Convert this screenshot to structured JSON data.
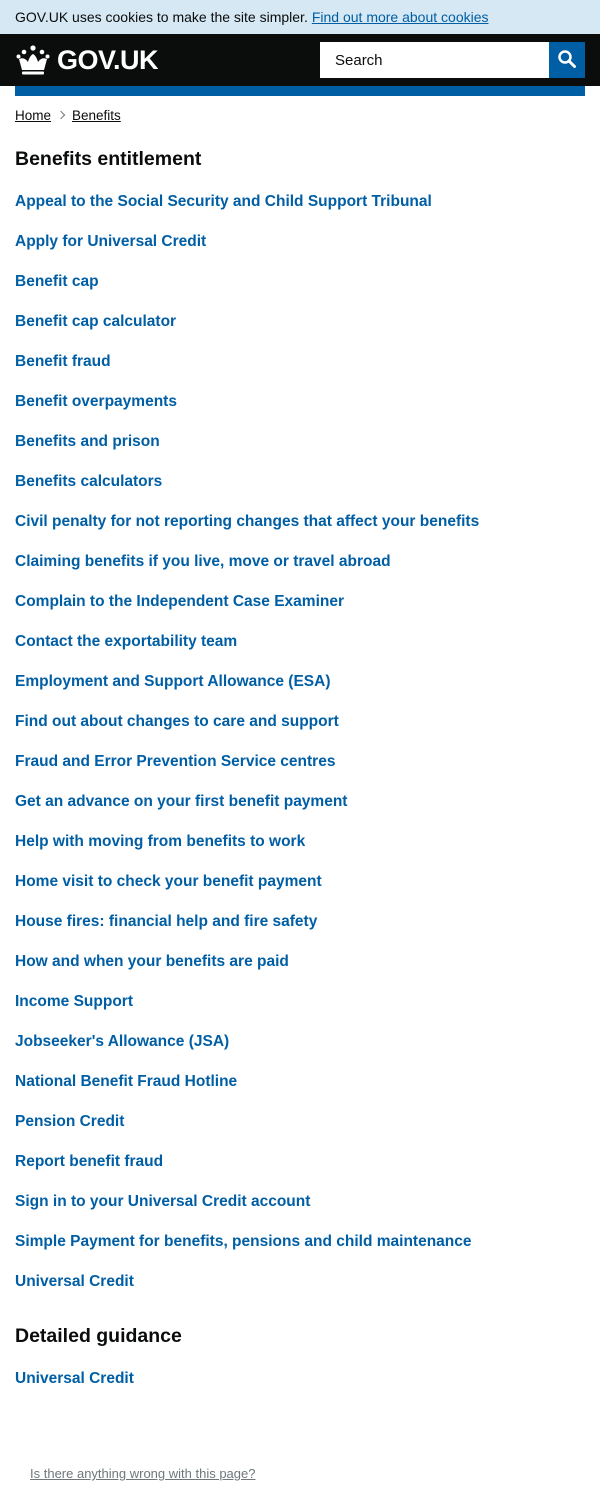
{
  "cookie_banner": {
    "text": "GOV.UK uses cookies to make the site simpler.",
    "link": "Find out more about cookies"
  },
  "header": {
    "logo_text": "GOV.UK",
    "search_placeholder": "Search",
    "logo_icon": "crown-icon",
    "search_icon": "search-icon"
  },
  "breadcrumb": [
    "Home",
    "Benefits"
  ],
  "sections": [
    {
      "title": "Benefits entitlement",
      "links": [
        "Appeal to the Social Security and Child Support Tribunal",
        "Apply for Universal Credit",
        "Benefit cap",
        "Benefit cap calculator",
        "Benefit fraud",
        "Benefit overpayments",
        "Benefits and prison",
        "Benefits calculators",
        "Civil penalty for not reporting changes that affect your benefits",
        "Claiming benefits if you live, move or travel abroad",
        "Complain to the Independent Case Examiner",
        "Contact the exportability team",
        "Employment and Support Allowance (ESA)",
        "Find out about changes to care and support",
        "Fraud and Error Prevention Service centres",
        "Get an advance on your first benefit payment",
        "Help with moving from benefits to work",
        "Home visit to check your benefit payment",
        "House fires: financial help and fire safety",
        "How and when your benefits are paid",
        "Income Support",
        "Jobseeker's Allowance (JSA)",
        "National Benefit Fraud Hotline",
        "Pension Credit",
        "Report benefit fraud",
        "Sign in to your Universal Credit account",
        "Simple Payment for benefits, pensions and child maintenance",
        "Universal Credit"
      ]
    },
    {
      "title": "Detailed guidance",
      "links": [
        "Universal Credit"
      ]
    }
  ],
  "feedback_link": "Is there anything wrong with this page?",
  "colors": {
    "link": "#005ea5",
    "header_bg": "#0b0c0c",
    "cookie_bg": "#d5e8f3",
    "text": "#0b0c0c"
  }
}
